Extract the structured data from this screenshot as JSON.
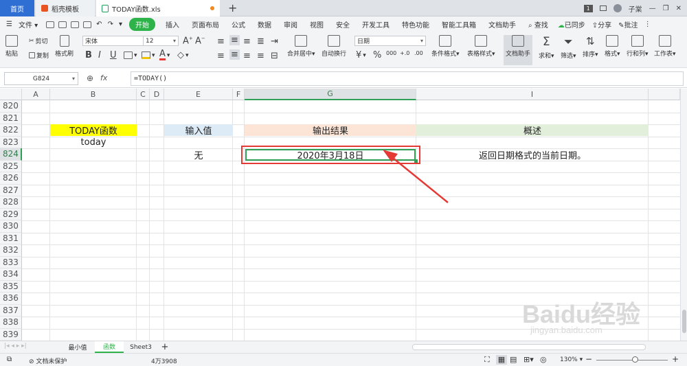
{
  "tabs": {
    "home": "首页",
    "template": "稻壳模板",
    "file": "TODAY函数.xls",
    "new_tab": "+"
  },
  "titlebar": {
    "window_count": "1",
    "user": "子棠"
  },
  "menu": {
    "file": "文件",
    "items": [
      "开始",
      "插入",
      "页面布局",
      "公式",
      "数据",
      "审阅",
      "视图",
      "安全",
      "开发工具",
      "特色功能",
      "智能工具箱",
      "文档助手"
    ],
    "search": "查找",
    "sync": "已同步",
    "share": "分享",
    "comment": "批注"
  },
  "ribbon": {
    "paste": "粘贴",
    "cut": "剪切",
    "copy": "复制",
    "format_painter": "格式刷",
    "font_name": "宋体",
    "font_size": "12",
    "merge_center": "合并居中",
    "wrap_text": "自动换行",
    "number_format": "日期",
    "conditional_format": "条件格式",
    "table_style": "表格样式",
    "doc_assistant": "文档助手",
    "sum": "求和",
    "filter": "筛选",
    "sort": "排序",
    "format": "格式",
    "rows_cols": "行和列",
    "worksheet": "工作表"
  },
  "formula_bar": {
    "name_box": "G824",
    "fx": "fx",
    "formula": "=TODAY()"
  },
  "columns": [
    "A",
    "B",
    "C",
    "D",
    "E",
    "F",
    "G",
    "I"
  ],
  "rows": [
    "820",
    "821",
    "822",
    "823",
    "824",
    "825",
    "826",
    "827",
    "828",
    "829",
    "830",
    "831",
    "832",
    "833",
    "834",
    "835",
    "836",
    "837",
    "838",
    "839"
  ],
  "cells": {
    "b822": "TODAY函数",
    "b823": "today",
    "e822": "输入值",
    "e824": "无",
    "g822": "输出结果",
    "g824": "2020年3月18日",
    "i822": "概述",
    "i824": "返回日期格式的当前日期。"
  },
  "sheets": [
    "最小值",
    "函数",
    "Sheet3"
  ],
  "status": {
    "protection": "文档未保护",
    "count": "4万3908",
    "zoom": "130%"
  },
  "watermark": {
    "brand": "Baidu经验",
    "url": "jingyan.baidu.com"
  },
  "colors": {
    "accent": "#2db34a",
    "yellow": "#ffff00",
    "blue_fill": "#ddebf7",
    "orange_fill": "#fce4d6",
    "green_fill": "#e2efda",
    "annotation": "#e53935"
  }
}
